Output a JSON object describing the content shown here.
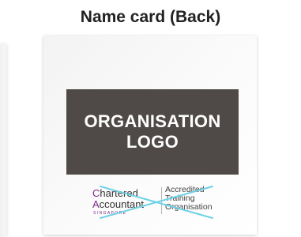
{
  "heading": "Name card (Back)",
  "card": {
    "logo_placeholder": {
      "line1": "ORGANISATION",
      "line2": "LOGO"
    },
    "badge": {
      "chartered_initial": "C",
      "chartered_rest": "hartered",
      "accountant_initial": "A",
      "accountant_rest": "ccountant",
      "country": "SINGAPORE",
      "ato_line1": "Accredited",
      "ato_line2": "Training",
      "ato_line3": "Organisation"
    }
  },
  "colors": {
    "logo_box": "#4f4a47",
    "brand_purple": "#7b2d8b",
    "cross_mark": "#6ed1e6"
  }
}
